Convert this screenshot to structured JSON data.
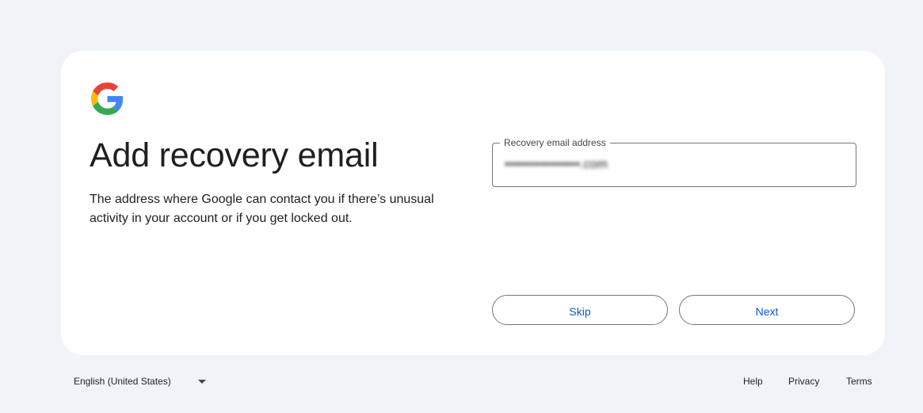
{
  "brand": {
    "logo_icon": "google-g-icon",
    "colors": {
      "blue": "#4285f4",
      "red": "#ea4335",
      "yellow": "#fbbc05",
      "green": "#34a853"
    }
  },
  "main": {
    "title": "Add recovery email",
    "description": "The address where Google can contact you if there’s unusual activity in your account or if you get locked out."
  },
  "form": {
    "email_label": "Recovery email address",
    "email_value": "•••••••••••••••••.com"
  },
  "actions": {
    "skip_label": "Skip",
    "next_label": "Next",
    "accent_color": "#0b57d0"
  },
  "footer": {
    "language": "English (United States)",
    "dropdown_icon": "caret-down-icon",
    "links": {
      "help": "Help",
      "privacy": "Privacy",
      "terms": "Terms"
    }
  }
}
